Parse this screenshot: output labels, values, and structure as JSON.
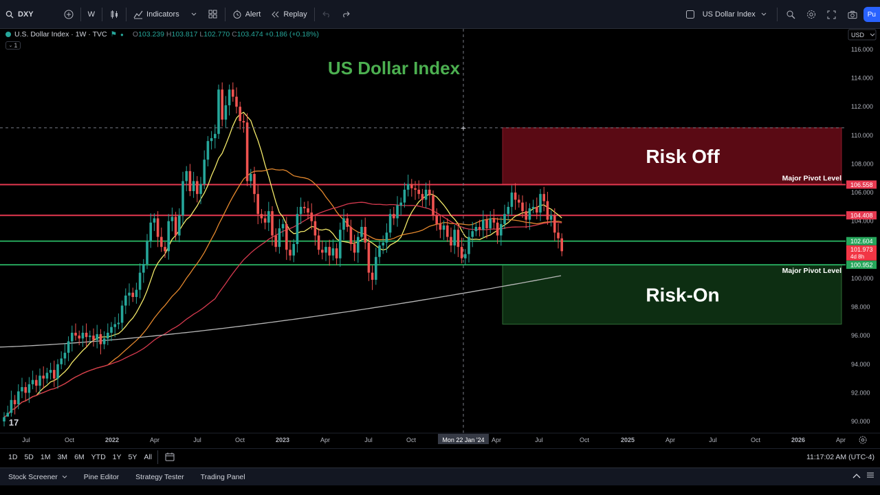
{
  "toolbar": {
    "symbol": "DXY",
    "interval": "W",
    "indicators_label": "Indicators",
    "alert_label": "Alert",
    "replay_label": "Replay",
    "symbol_name": "US Dollar Index",
    "publish_label": "Pu"
  },
  "legend": {
    "title": "U.S. Dollar Index · 1W · TVC",
    "open": "103.239",
    "high": "103.817",
    "low": "102.770",
    "close": "103.474",
    "change": "+0.186 (+0.18%)",
    "sub_count": "1"
  },
  "chart_data": {
    "type": "candlestick",
    "title": "US Dollar Index",
    "currency": "USD",
    "y_ticks": [
      "116.000",
      "114.000",
      "112.000",
      "110.000",
      "108.000",
      "106.000",
      "104.000",
      "102.000",
      "100.000",
      "98.000",
      "96.000",
      "94.000",
      "92.000",
      "90.000"
    ],
    "x_ticks": [
      "Jul",
      "Oct",
      "2022",
      "Apr",
      "Jul",
      "Oct",
      "2023",
      "Apr",
      "Jul",
      "Oct",
      "Jan",
      "Apr",
      "Jul",
      "Oct",
      "2025",
      "Apr",
      "Jul",
      "Oct",
      "2026",
      "Apr"
    ],
    "x_tick_years": [
      "2022",
      "2023",
      "2025",
      "2026"
    ],
    "crosshair_date": "Mon 22 Jan '24",
    "crosshair_price": "110.526",
    "zones": [
      {
        "label": "Risk Off",
        "from": 106.558,
        "to": 110.526,
        "color": "#5a0a14"
      },
      {
        "label": "Risk-On",
        "from": 96.8,
        "to": 100.952,
        "color": "#0d2e12"
      }
    ],
    "levels": [
      {
        "price": 106.558,
        "label": "106.558",
        "color": "#e63950"
      },
      {
        "price": 104.408,
        "label": "104.408",
        "color": "#e63950"
      },
      {
        "price": 102.604,
        "label": "102.604",
        "color": "#26a65b"
      },
      {
        "price": 100.952,
        "label": "100.952",
        "color": "#26a65b"
      }
    ],
    "pivot_labels": [
      "Major Pivot Level",
      "Major Pivot Level"
    ],
    "last_price": "101.973",
    "last_countdown": "4d 8h",
    "series_ohlc_note": "weekly candles Jun 2021 – Aug 2024 approx",
    "closes": [
      90.3,
      90.6,
      91.5,
      91.2,
      92.1,
      92.4,
      92.0,
      92.6,
      92.9,
      92.5,
      93.2,
      93.0,
      93.4,
      93.6,
      93.0,
      94.0,
      94.4,
      94.8,
      95.6,
      96.2,
      96.0,
      95.8,
      96.2,
      95.9,
      96.0,
      95.7,
      96.1,
      95.4,
      95.8,
      96.2,
      96.6,
      96.8,
      96.9,
      98.1,
      98.8,
      99.0,
      98.7,
      99.2,
      100.4,
      101.0,
      102.6,
      103.9,
      104.2,
      102.9,
      102.2,
      101.9,
      104.0,
      104.3,
      103.0,
      104.4,
      106.8,
      107.5,
      106.1,
      106.8,
      105.9,
      106.6,
      108.3,
      109.6,
      109.8,
      110.1,
      113.2,
      111.1,
      112.1,
      113.2,
      112.7,
      112.0,
      111.0,
      110.9,
      106.8,
      107.3,
      105.9,
      104.5,
      104.2,
      103.9,
      104.7,
      103.0,
      102.2,
      103.5,
      103.8,
      102.0,
      101.6,
      102.4,
      104.5,
      105.0,
      104.9,
      104.6,
      104.0,
      103.0,
      102.0,
      101.8,
      102.2,
      101.6,
      102.1,
      101.4,
      103.4,
      104.2,
      103.6,
      102.4,
      101.8,
      102.9,
      103.6,
      102.5,
      100.4,
      99.9,
      101.5,
      102.3,
      102.5,
      103.2,
      104.5,
      104.2,
      105.1,
      105.3,
      106.2,
      106.6,
      106.3,
      106.2,
      105.9,
      105.5,
      106.2,
      105.8,
      104.4,
      103.8,
      103.4,
      103.7,
      102.9,
      102.3,
      103.4,
      102.2,
      101.4,
      101.7,
      102.9,
      103.3,
      103.6,
      103.4,
      104.1,
      103.5,
      104.2,
      103.9,
      103.0,
      103.8,
      104.5,
      105.0,
      106.0,
      105.5,
      105.3,
      104.7,
      104.1,
      104.9,
      105.0,
      104.6,
      105.9,
      105.4,
      104.1,
      104.4,
      103.2,
      102.8,
      101.9
    ]
  },
  "range_buttons": [
    "1D",
    "5D",
    "1M",
    "3M",
    "6M",
    "YTD",
    "1Y",
    "5Y",
    "All"
  ],
  "clock": "11:17:02 AM (UTC-4)",
  "panel_tabs": [
    "Stock Screener",
    "Pine Editor",
    "Strategy Tester",
    "Trading Panel"
  ]
}
